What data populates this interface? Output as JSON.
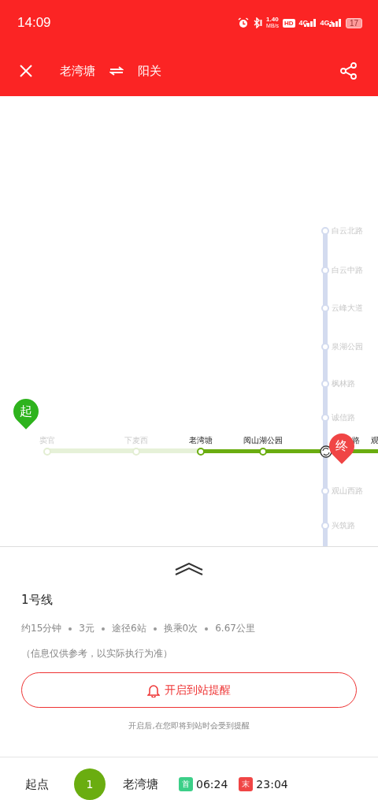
{
  "status_bar": {
    "time": "14:09",
    "speed": "1.40",
    "speed_unit": "MB/s",
    "hd": "HD",
    "net1": "4G",
    "net2": "4G+",
    "battery": "17"
  },
  "header": {
    "from": "老湾塘",
    "to": "阳关"
  },
  "map": {
    "start_pin": "起",
    "end_pin": "终",
    "line_h": [
      {
        "name": "窦官",
        "passed": false
      },
      {
        "name": "下麦西",
        "passed": false
      },
      {
        "name": "老湾塘",
        "passed": true
      },
      {
        "name": "阅山湖公园",
        "passed": true
      },
      {
        "name": "路",
        "passed": true
      },
      {
        "name": "观",
        "passed": true
      }
    ],
    "line_v": [
      "白云北路",
      "白云中路",
      "云峰大道",
      "泉湖公园",
      "枫林路",
      "诚信路",
      "观山西路",
      "兴筑路"
    ]
  },
  "sheet": {
    "line": "1号线",
    "stats": [
      "约15分钟",
      "3元",
      "途径6站",
      "换乘0次",
      "6.67公里"
    ],
    "note": "（信息仅供参考，以实际执行为准）",
    "remind_button": "开启到站提醒",
    "remind_hint": "开启后,在您即将到站时会受到提醒"
  },
  "first_row": {
    "label": "起点",
    "line_no": "1",
    "station": "老湾塘",
    "first_tag": "首",
    "first_time": "06:24",
    "last_tag": "末",
    "last_time": "23:04"
  }
}
